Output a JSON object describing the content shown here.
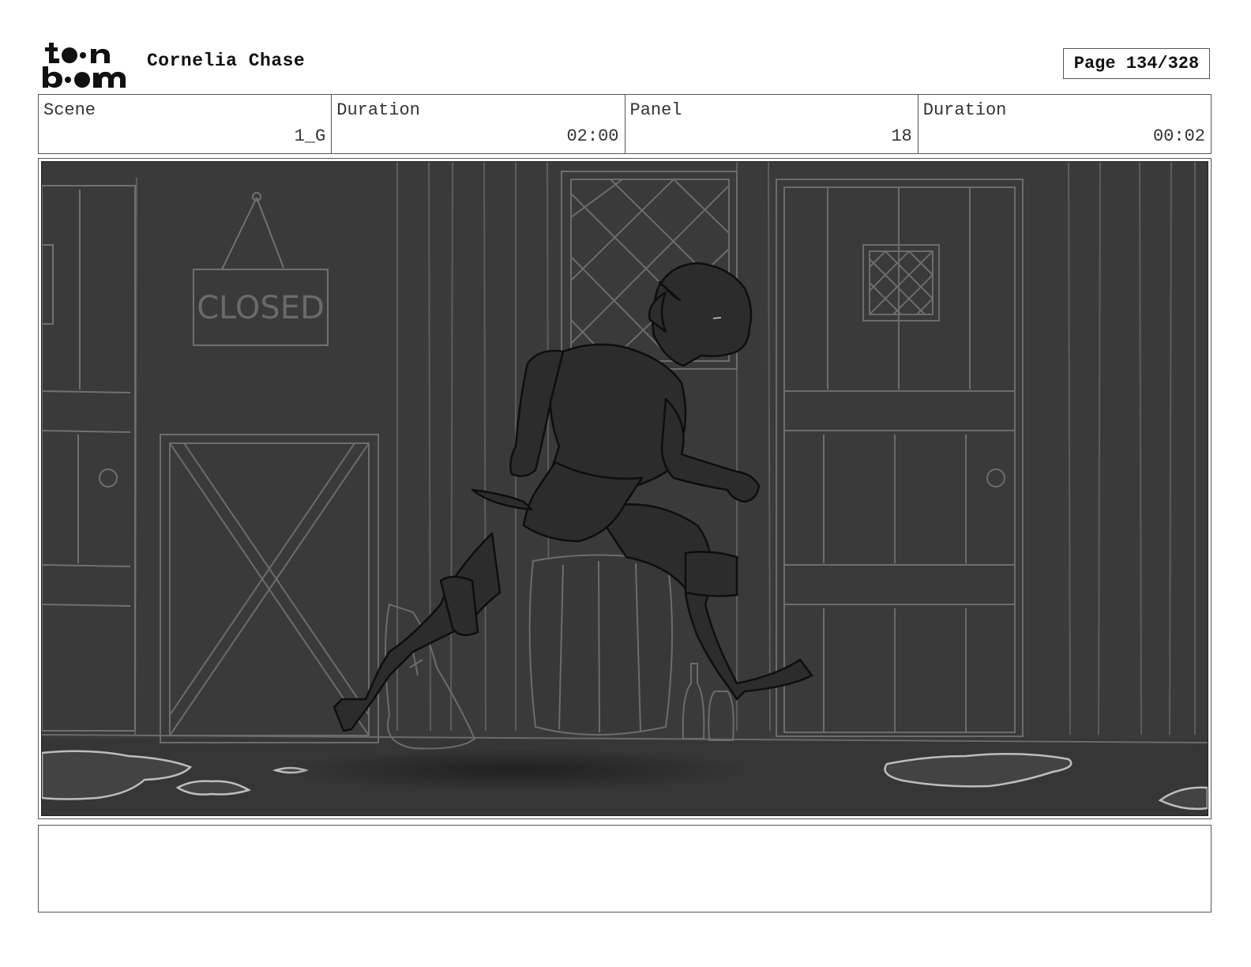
{
  "header": {
    "logo_text_top": "toon",
    "logo_text_bottom": "boom",
    "project_title": "Cornelia Chase",
    "page_label": "Page 134/328"
  },
  "info": {
    "scene_label": "Scene",
    "scene_value": "1_G",
    "duration_label": "Duration",
    "duration_value": "02:00",
    "panel_label": "Panel",
    "panel_value": "18",
    "panel_duration_label": "Duration",
    "panel_duration_value": "00:02"
  },
  "panel": {
    "sign_text": "CLOSED"
  },
  "notes": {
    "text": ""
  }
}
